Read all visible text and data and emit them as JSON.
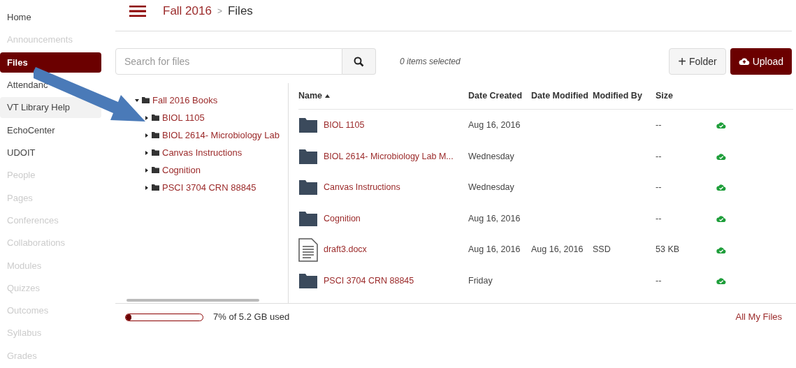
{
  "sidebar": {
    "items": [
      {
        "label": "Home",
        "selected": false,
        "disabled": false,
        "highlighted": false
      },
      {
        "label": "Announcements",
        "selected": false,
        "disabled": true,
        "highlighted": false
      },
      {
        "label": "Files",
        "selected": true,
        "disabled": false,
        "highlighted": false
      },
      {
        "label": "Attendanc",
        "selected": false,
        "disabled": false,
        "highlighted": false
      },
      {
        "label": "VT Library Help",
        "selected": false,
        "disabled": false,
        "highlighted": true
      },
      {
        "label": "EchoCenter",
        "selected": false,
        "disabled": false,
        "highlighted": false
      },
      {
        "label": "UDOIT",
        "selected": false,
        "disabled": false,
        "highlighted": false
      },
      {
        "label": "People",
        "selected": false,
        "disabled": true,
        "highlighted": false
      },
      {
        "label": "Pages",
        "selected": false,
        "disabled": true,
        "highlighted": false
      },
      {
        "label": "Conferences",
        "selected": false,
        "disabled": true,
        "highlighted": false
      },
      {
        "label": "Collaborations",
        "selected": false,
        "disabled": true,
        "highlighted": false
      },
      {
        "label": "Modules",
        "selected": false,
        "disabled": true,
        "highlighted": false
      },
      {
        "label": "Quizzes",
        "selected": false,
        "disabled": true,
        "highlighted": false
      },
      {
        "label": "Outcomes",
        "selected": false,
        "disabled": true,
        "highlighted": false
      },
      {
        "label": "Syllabus",
        "selected": false,
        "disabled": true,
        "highlighted": false
      },
      {
        "label": "Grades",
        "selected": false,
        "disabled": true,
        "highlighted": false
      }
    ]
  },
  "breadcrumb": [
    "Fall 2016",
    "Files"
  ],
  "breadcrumb_separator": ">",
  "search": {
    "placeholder": "Search for files"
  },
  "selection_status": "0 items selected",
  "buttons": {
    "folder_icon": "+",
    "folder": "Folder",
    "upload": "Upload"
  },
  "tree": [
    {
      "label": "Fall 2016 Books",
      "expanded": true,
      "children": [
        {
          "label": "BIOL 1105",
          "expanded": false
        },
        {
          "label": "BIOL 2614- Microbiology Lab",
          "expanded": false
        },
        {
          "label": "Canvas Instructions",
          "expanded": false
        },
        {
          "label": "Cognition",
          "expanded": false
        },
        {
          "label": "PSCI 3704 CRN 88845",
          "expanded": false
        }
      ]
    }
  ],
  "table": {
    "columns": [
      "Name",
      "Date Created",
      "Date Modified",
      "Modified By",
      "Size"
    ],
    "rows": [
      {
        "kind": "folder",
        "name": "BIOL 1105",
        "created": "Aug 16, 2016",
        "modified": "",
        "modified_by": "",
        "size": "--",
        "published": true
      },
      {
        "kind": "folder",
        "name": "BIOL 2614- Microbiology Lab M...",
        "created": "Wednesday",
        "modified": "",
        "modified_by": "",
        "size": "--",
        "published": true
      },
      {
        "kind": "folder",
        "name": "Canvas Instructions",
        "created": "Wednesday",
        "modified": "",
        "modified_by": "",
        "size": "--",
        "published": true
      },
      {
        "kind": "folder",
        "name": "Cognition",
        "created": "Aug 16, 2016",
        "modified": "",
        "modified_by": "",
        "size": "--",
        "published": true
      },
      {
        "kind": "document",
        "name": "draft3.docx",
        "created": "Aug 16, 2016",
        "modified": "Aug 16, 2016",
        "modified_by": "SSD",
        "size": "53 KB",
        "published": true
      },
      {
        "kind": "folder",
        "name": "PSCI 3704 CRN 88845",
        "created": "Friday",
        "modified": "",
        "modified_by": "",
        "size": "--",
        "published": true
      }
    ]
  },
  "storage": {
    "level": 0.07,
    "reading": "7% of 5.2 GB used"
  },
  "all_files_link": "All My Files"
}
